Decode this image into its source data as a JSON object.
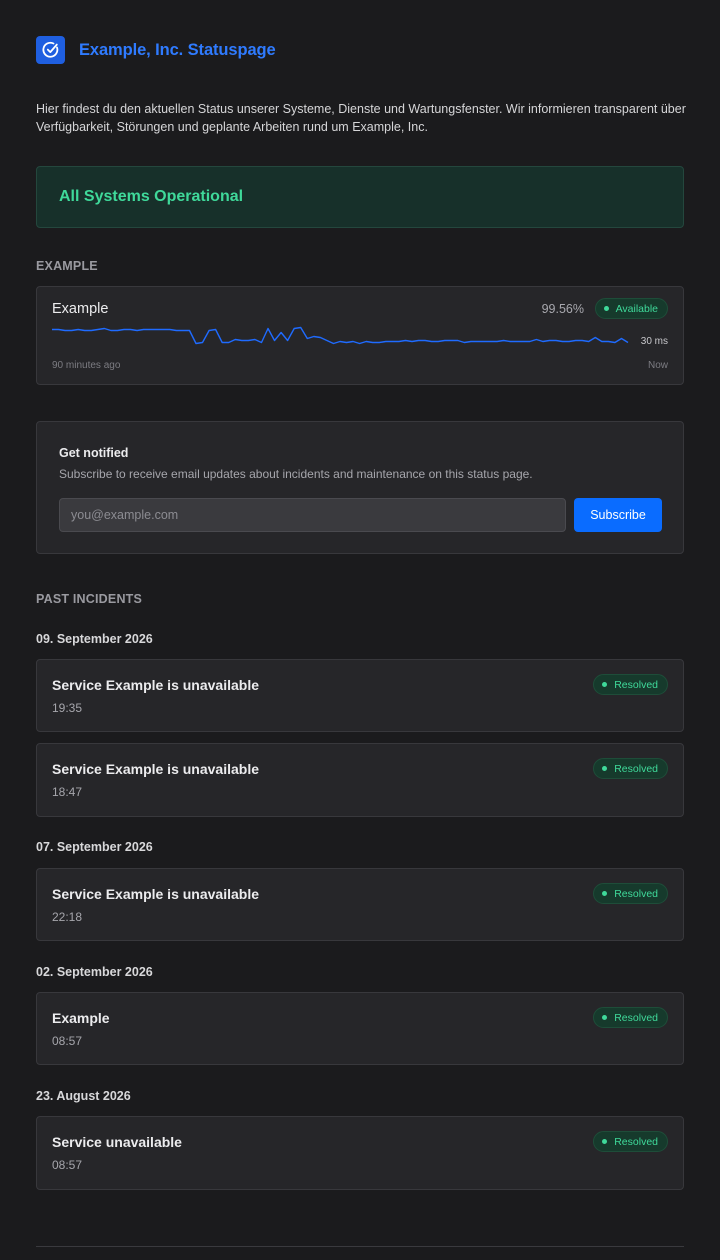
{
  "header": {
    "title": "Example, Inc. Statuspage",
    "logo_icon": "check-circle-icon"
  },
  "intro": "Hier findest du den aktuellen Status unserer Systeme, Dienste und Wartungsfenster. Wir informieren transparent über Verfügbarkeit, Störungen und geplante Arbeiten rund um Example, Inc.",
  "status": {
    "text": "All Systems Operational",
    "color": "#3fd99a"
  },
  "services_section": {
    "title": "EXAMPLE",
    "service": {
      "name": "Example",
      "uptime": "99.56%",
      "badge": "Available",
      "latency_label": "30 ms",
      "axis_start": "90 minutes ago",
      "axis_end": "Now",
      "line_color": "#1f6bff"
    }
  },
  "subscribe": {
    "title": "Get notified",
    "description": "Subscribe to receive email updates about incidents and maintenance on this status page.",
    "placeholder": "you@example.com",
    "button": "Subscribe"
  },
  "incidents": {
    "title": "PAST INCIDENTS",
    "groups": [
      {
        "date": "09. September 2026",
        "items": [
          {
            "title": "Service Example is unavailable",
            "time": "19:35",
            "status": "Resolved"
          },
          {
            "title": "Service Example is unavailable",
            "time": "18:47",
            "status": "Resolved"
          }
        ]
      },
      {
        "date": "07. September 2026",
        "items": [
          {
            "title": "Service Example is unavailable",
            "time": "22:18",
            "status": "Resolved"
          }
        ]
      },
      {
        "date": "02. September 2026",
        "items": [
          {
            "title": "Example",
            "time": "08:57",
            "status": "Resolved"
          }
        ]
      },
      {
        "date": "23. August 2026",
        "items": [
          {
            "title": "Service unavailable",
            "time": "08:57",
            "status": "Resolved"
          }
        ]
      }
    ]
  }
}
